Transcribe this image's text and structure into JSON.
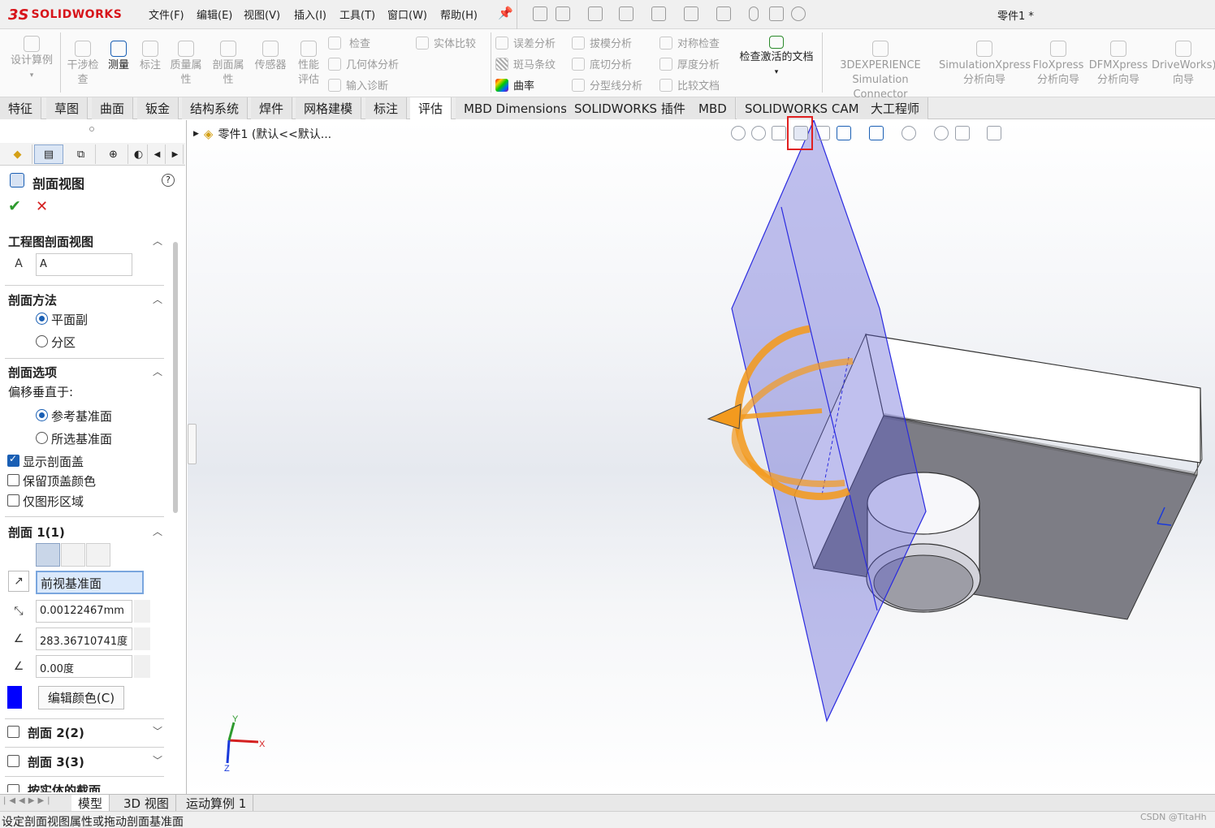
{
  "app": {
    "brand_ds": "3S",
    "brand_name": "SOLIDWORKS",
    "doc_title": "零件1 *"
  },
  "menu": [
    "文件(F)",
    "编辑(E)",
    "视图(V)",
    "插入(I)",
    "工具(T)",
    "窗口(W)",
    "帮助(H)"
  ],
  "ribbon": {
    "design_study": "设计算例",
    "interference": "干涉检查",
    "measure": "测量",
    "markup": "标注",
    "mass_props": "质量属性",
    "section_props": "剖面属性",
    "sensor": "传感器",
    "perf_eval": "性能评估",
    "check": "检查",
    "geom_analysis": "几何体分析",
    "import_diag": "输入诊断",
    "solid_compare": "实体比较",
    "deviation": "误差分析",
    "zebra": "斑马条纹",
    "curvature": "曲率",
    "draft": "拔模分析",
    "undercut": "底切分析",
    "parting_line": "分型线分析",
    "symmetry": "对称检查",
    "thickness": "厚度分析",
    "compare_docs": "比较文档",
    "check_active": "检查激活的文档",
    "exp_sim_1": "3DEXPERIENCE",
    "exp_sim_2": "Simulation Connector",
    "simx_1": "SimulationXpress",
    "simx_2": "分析向导",
    "flox_1": "FloXpress",
    "flox_2": "分析向导",
    "dfmx_1": "DFMXpress",
    "dfmx_2": "分析向导",
    "drivex_1": "DriveWorks)",
    "drivex_2": "向导"
  },
  "tabs": [
    "特征",
    "草图",
    "曲面",
    "钣金",
    "结构系统",
    "焊件",
    "网格建模",
    "标注",
    "评估",
    "MBD Dimensions",
    "SOLIDWORKS 插件",
    "MBD",
    "SOLIDWORKS CAM",
    "大工程师"
  ],
  "active_tab": "评估",
  "panel": {
    "title": "剖面视图",
    "help": "?",
    "sec_drawing": "工程图剖面视图",
    "label_value": "A",
    "sec_method": "剖面方法",
    "method_plane": "平面副",
    "method_zonal": "分区",
    "sec_options": "剖面选项",
    "offset_normal": "偏移垂直于:",
    "opt_ref_plane": "参考基准面",
    "opt_sel_plane": "所选基准面",
    "show_cap": "显示剖面盖",
    "keep_cap_color": "保留顶盖颜色",
    "graphics_only": "仅图形区域",
    "sec1": "剖面 1(1)",
    "plane_value": "前视基准面",
    "offset_value": "0.00122467mm",
    "angle_x_value": "283.36710741度",
    "angle_y_value": "0.00度",
    "edit_color": "编辑颜色(C)",
    "cap_color": "#0000ff",
    "sec2": "剖面 2(2)",
    "sec3": "剖面 3(3)",
    "sec_bodies": "按实体的截面"
  },
  "viewport": {
    "tree_item": "零件1  (默认<<默认...",
    "axis_x": "X",
    "axis_y": "Y",
    "axis_z": "Z"
  },
  "bottom_tabs": [
    "模型",
    "3D 视图",
    "运动算例 1"
  ],
  "active_bottom_tab": "模型",
  "status": "设定剖面视图属性或拖动剖面基准面",
  "watermark": "CSDN @TitaHh"
}
